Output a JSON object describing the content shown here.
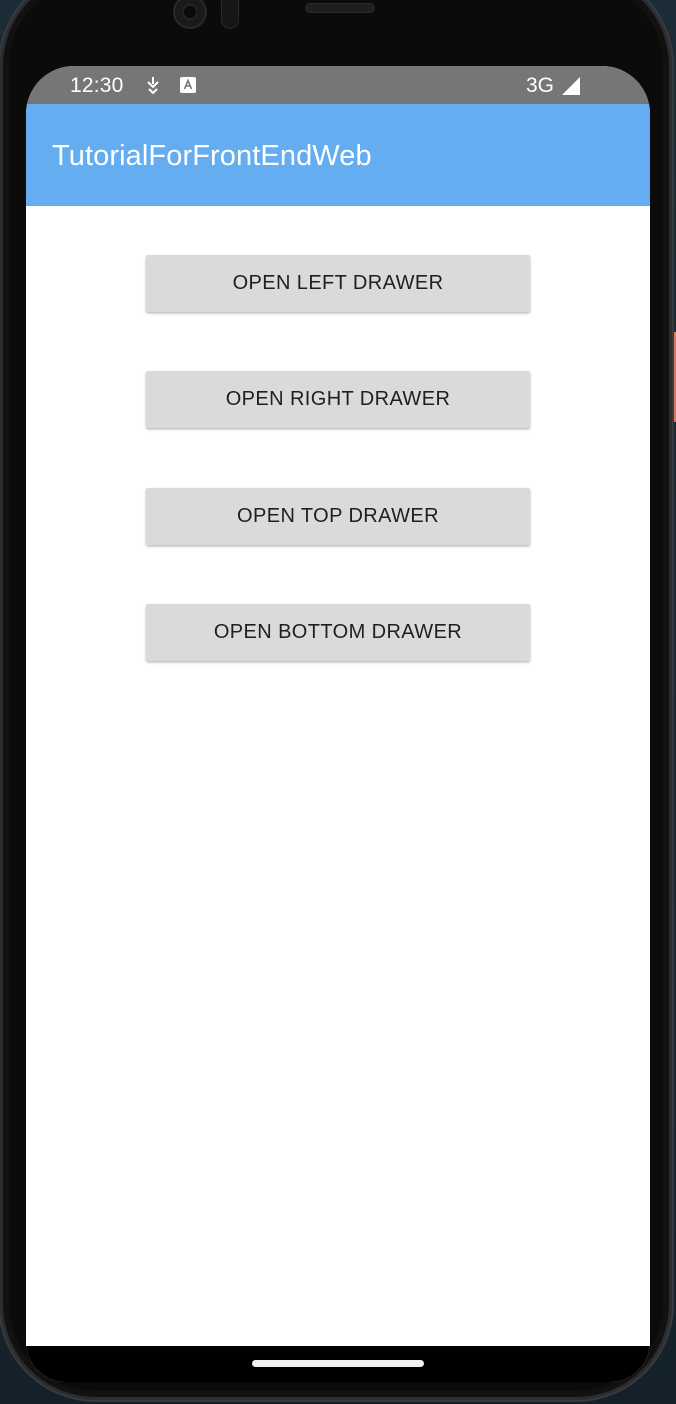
{
  "status_bar": {
    "time": "12:30",
    "network": "3G",
    "icons": [
      "download-status-icon",
      "keyboard-a-icon",
      "signal-icon"
    ]
  },
  "app_bar": {
    "title": "TutorialForFrontEndWeb",
    "color": "#63adf0"
  },
  "buttons": {
    "left": "OPEN LEFT DRAWER",
    "right": "OPEN RIGHT DRAWER",
    "top": "OPEN TOP DRAWER",
    "bottom": "OPEN BOTTOM DRAWER"
  },
  "colors": {
    "button_bg": "#d9dadb",
    "status_bar_bg": "#767676"
  }
}
